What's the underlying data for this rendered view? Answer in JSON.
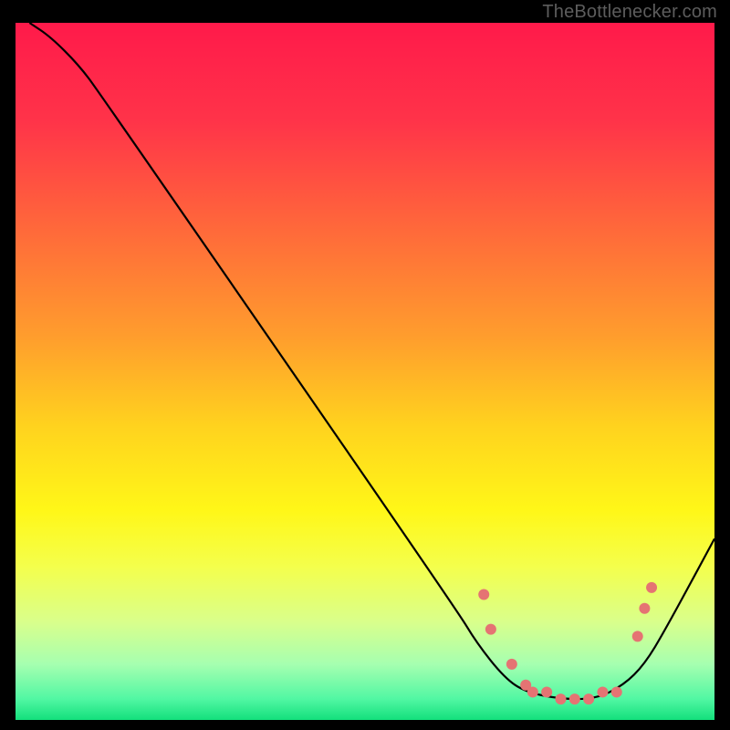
{
  "watermark": "TheBottlenecker.com",
  "gradient_stops": [
    {
      "offset": 0.0,
      "color": "#ff1a4a"
    },
    {
      "offset": 0.14,
      "color": "#ff3349"
    },
    {
      "offset": 0.3,
      "color": "#ff6a3a"
    },
    {
      "offset": 0.45,
      "color": "#ff9d2d"
    },
    {
      "offset": 0.58,
      "color": "#ffd31e"
    },
    {
      "offset": 0.7,
      "color": "#fff718"
    },
    {
      "offset": 0.78,
      "color": "#f4ff4c"
    },
    {
      "offset": 0.86,
      "color": "#d9ff8c"
    },
    {
      "offset": 0.92,
      "color": "#a6ffb0"
    },
    {
      "offset": 0.97,
      "color": "#51f7a3"
    },
    {
      "offset": 1.0,
      "color": "#13e07c"
    }
  ],
  "chart_data": {
    "type": "line",
    "title": "",
    "xlabel": "",
    "ylabel": "",
    "xlim": [
      0,
      100
    ],
    "ylim": [
      0,
      100
    ],
    "grid": false,
    "curve": {
      "name": "bottleneck-curve",
      "points": [
        {
          "x": 2,
          "y": 100
        },
        {
          "x": 5,
          "y": 98
        },
        {
          "x": 9,
          "y": 94
        },
        {
          "x": 12,
          "y": 90
        },
        {
          "x": 63,
          "y": 16
        },
        {
          "x": 66,
          "y": 11
        },
        {
          "x": 70,
          "y": 6
        },
        {
          "x": 73,
          "y": 4
        },
        {
          "x": 78,
          "y": 3
        },
        {
          "x": 83,
          "y": 3
        },
        {
          "x": 87,
          "y": 5
        },
        {
          "x": 90,
          "y": 8
        },
        {
          "x": 93,
          "y": 13
        },
        {
          "x": 100,
          "y": 26
        }
      ]
    },
    "markers": {
      "name": "highlight-dots",
      "color": "#e57373",
      "radius_px": 6,
      "points": [
        {
          "x": 67,
          "y": 18
        },
        {
          "x": 68,
          "y": 13
        },
        {
          "x": 71,
          "y": 8
        },
        {
          "x": 73,
          "y": 5
        },
        {
          "x": 74,
          "y": 4
        },
        {
          "x": 76,
          "y": 4
        },
        {
          "x": 78,
          "y": 3
        },
        {
          "x": 80,
          "y": 3
        },
        {
          "x": 82,
          "y": 3
        },
        {
          "x": 84,
          "y": 4
        },
        {
          "x": 86,
          "y": 4
        },
        {
          "x": 89,
          "y": 12
        },
        {
          "x": 90,
          "y": 16
        },
        {
          "x": 91,
          "y": 19
        }
      ]
    }
  }
}
